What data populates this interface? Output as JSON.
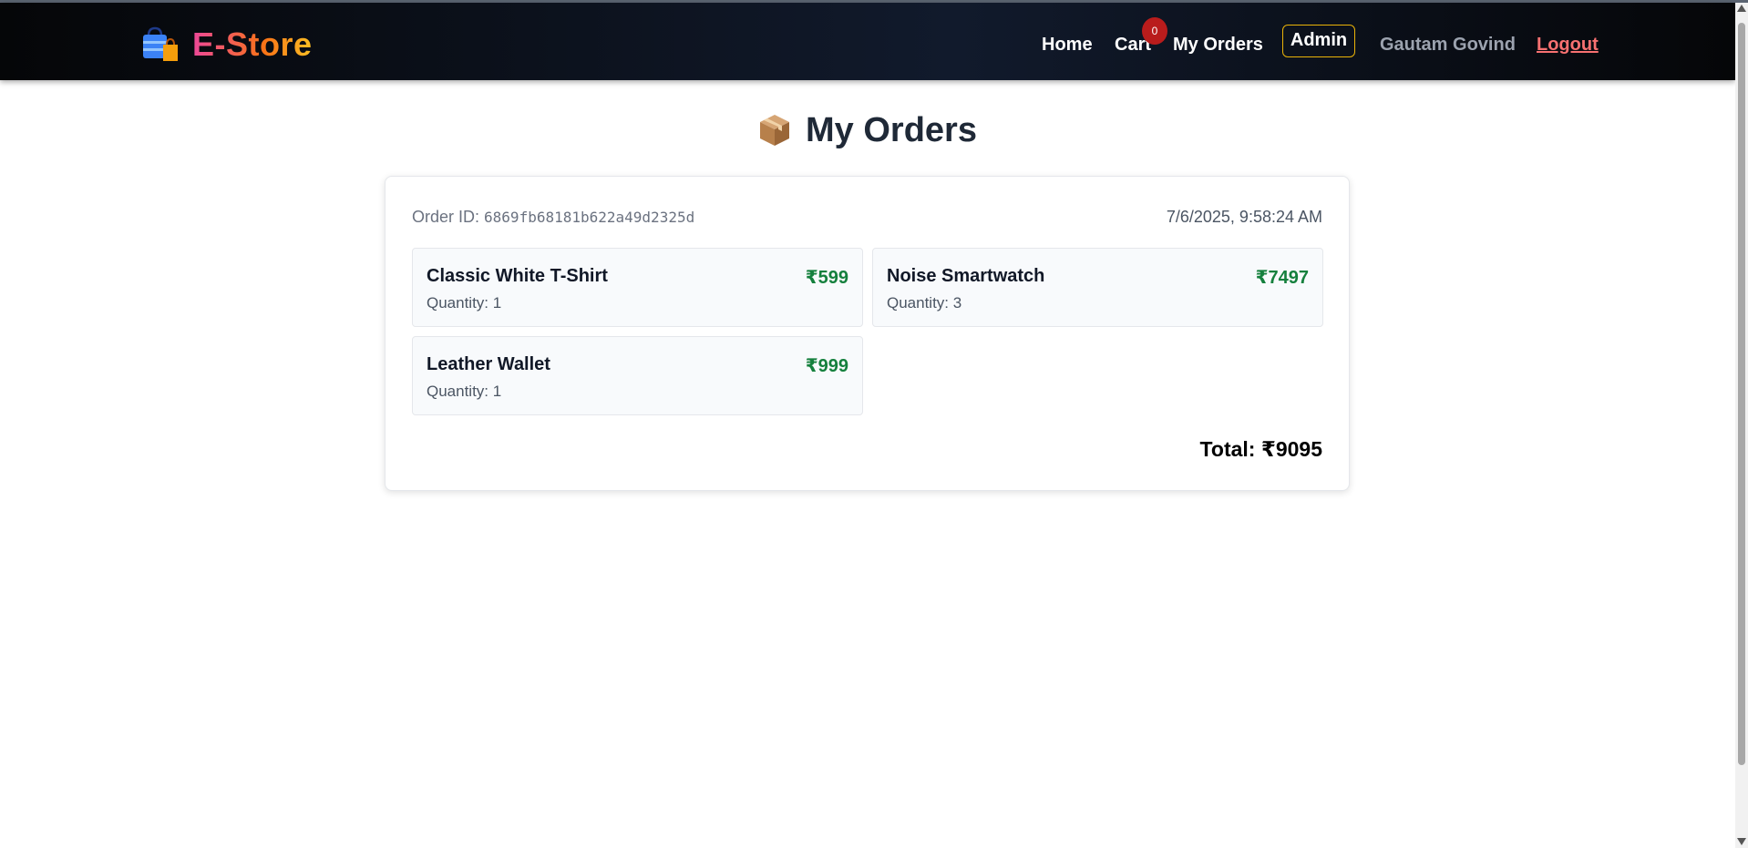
{
  "navbar": {
    "brand": "E-Store",
    "brand_icon": "shopping-bag-icon",
    "links": {
      "home": "Home",
      "cart": "Cart",
      "my_orders": "My Orders",
      "admin": "Admin"
    },
    "cart_count": "0",
    "user_name": "Gautam Govind",
    "logout": "Logout"
  },
  "page": {
    "title": "My Orders",
    "title_icon": "package-icon"
  },
  "order": {
    "id_label": "Order ID:",
    "id": "6869fb68181b622a49d2325d",
    "date": "7/6/2025, 9:58:24 AM",
    "items": [
      {
        "name": "Classic White T-Shirt",
        "price": "₹599",
        "quantity": "Quantity: 1"
      },
      {
        "name": "Noise Smartwatch",
        "price": "₹7497",
        "quantity": "Quantity: 3"
      },
      {
        "name": "Leather Wallet",
        "price": "₹999",
        "quantity": "Quantity: 1"
      }
    ],
    "total": "Total: ₹9095"
  },
  "colors": {
    "navbar_bg": "#0b1020",
    "price_green": "#15803d",
    "badge_red": "#b91c1c",
    "admin_border": "#eab308",
    "logout_red": "#f87171"
  }
}
